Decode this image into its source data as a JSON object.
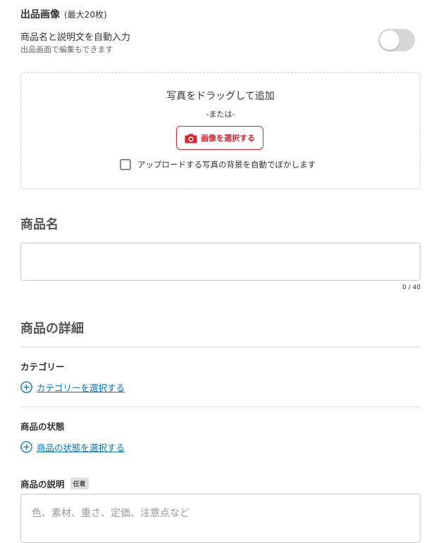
{
  "images": {
    "title": "出品画像",
    "max_note": "(最大20枚)",
    "auto_fill_label": "商品名と説明文を自動入力",
    "auto_fill_sub": "出品画面で編集もできます",
    "auto_fill_enabled": false,
    "drop_title": "写真をドラッグして追加",
    "drop_or": "-または-",
    "select_button_label": "画像を選択する",
    "blur_background_label": "アップロードする写真の背景を自動でぼかします",
    "blur_background_checked": false
  },
  "product_name": {
    "title": "商品名",
    "value": "",
    "counter": "0 / 40"
  },
  "details": {
    "title": "商品の詳細",
    "category_label": "カテゴリー",
    "category_link": "カテゴリーを選択する",
    "condition_label": "商品の状態",
    "condition_link": "商品の状態を選択する",
    "description_label": "商品の説明",
    "description_badge": "任意",
    "description_placeholder": "色、素材、重さ、定価、注意点など"
  },
  "colors": {
    "accent_red": "#e2202b",
    "link_blue": "#0073cc",
    "toggle_off": "#d6d6d6"
  },
  "icons": {
    "camera": "camera-icon",
    "add": "plus-circle-icon"
  }
}
